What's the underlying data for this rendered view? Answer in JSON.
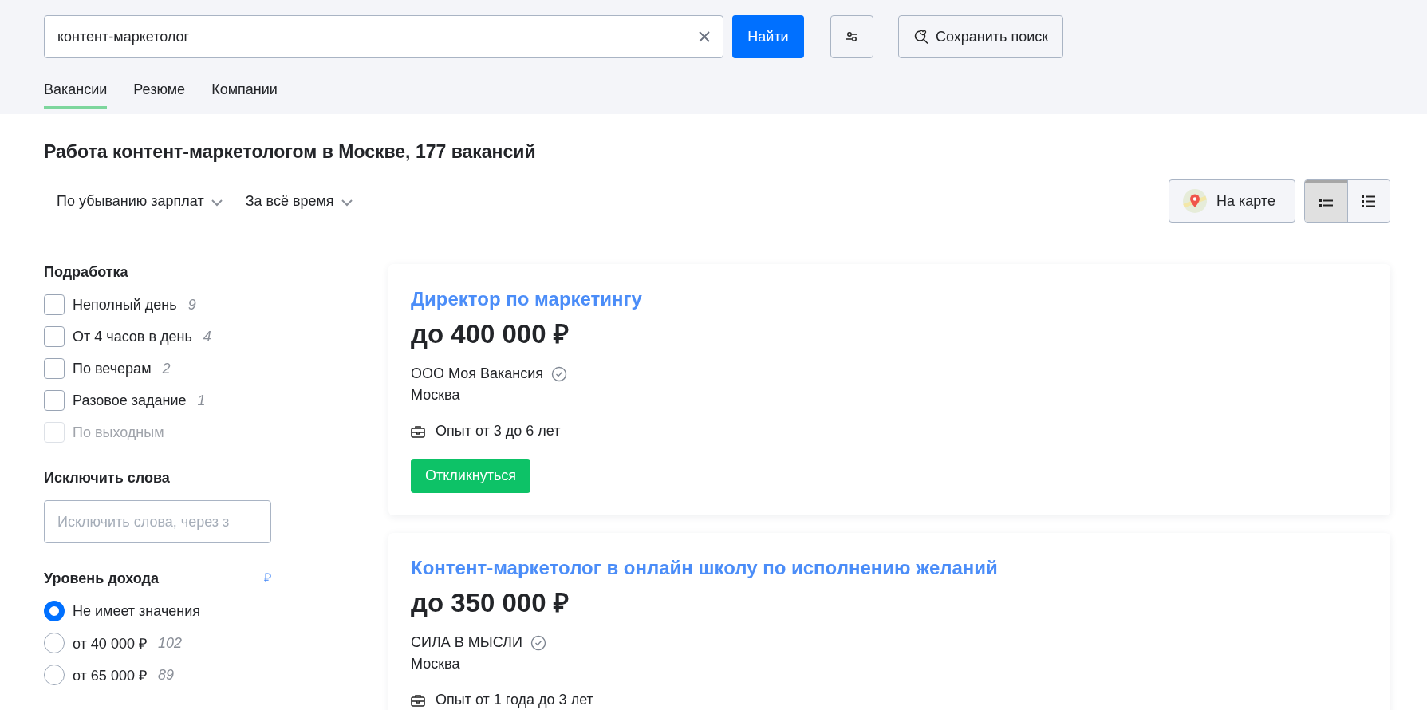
{
  "search": {
    "value": "контент-маркетолог",
    "submit": "Найти",
    "save": "Сохранить поиск"
  },
  "tabs": [
    {
      "label": "Вакансии",
      "selected": true
    },
    {
      "label": "Резюме",
      "selected": false
    },
    {
      "label": "Компании",
      "selected": false
    }
  ],
  "heading": "Работа контент-маркетологом в Москве, 177 вакансий",
  "sort": [
    {
      "label": "По убыванию зарплат"
    },
    {
      "label": "За всё время"
    }
  ],
  "map_button": "На карте",
  "view_modes": [
    {
      "kind": "compact",
      "selected": true
    },
    {
      "kind": "detailed",
      "selected": false
    }
  ],
  "filters": {
    "part_time": {
      "title": "Подработка",
      "options": [
        {
          "label": "Неполный день",
          "count": "9",
          "checked": false,
          "disabled": false
        },
        {
          "label": "От 4 часов в день",
          "count": "4",
          "checked": false,
          "disabled": false
        },
        {
          "label": "По вечерам",
          "count": "2",
          "checked": false,
          "disabled": false
        },
        {
          "label": "Разовое задание",
          "count": "1",
          "checked": false,
          "disabled": false
        },
        {
          "label": "По выходным",
          "checked": false,
          "disabled": true
        }
      ]
    },
    "exclude": {
      "title": "Исключить слова",
      "placeholder": "Исключить слова, через з"
    },
    "income": {
      "title": "Уровень дохода",
      "currency": "₽",
      "options": [
        {
          "label": "Не имеет значения",
          "selected": true
        },
        {
          "label": "от 40 000 ₽",
          "count": "102",
          "selected": false
        },
        {
          "label": "от 65 000 ₽",
          "count": "89",
          "selected": false
        }
      ]
    }
  },
  "vacancies": [
    {
      "title": "Директор по маркетингу",
      "salary": "до 400 000 ₽",
      "company": "ООО Моя Вакансия",
      "verified": true,
      "city": "Москва",
      "experience": "Опыт от 3 до 6 лет",
      "action": "Откликнуться"
    },
    {
      "title": "Контент-маркетолог в онлайн школу по исполнению желаний",
      "salary": "до 350 000 ₽",
      "company": "СИЛА В МЫСЛИ",
      "verified": true,
      "city": "Москва",
      "experience": "Опыт от 1 года до 3 лет"
    }
  ]
}
